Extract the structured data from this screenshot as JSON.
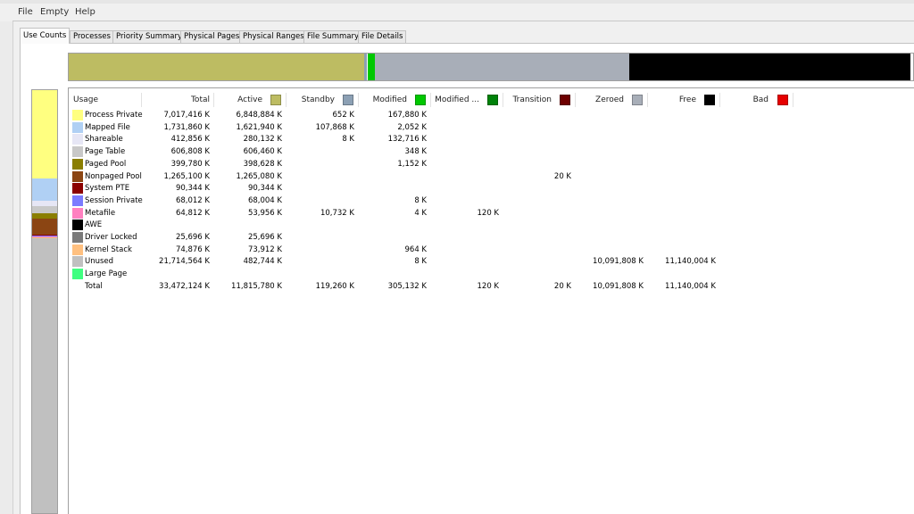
{
  "menu": [
    "File",
    "Empty",
    "Help"
  ],
  "tabs": [
    "Use Counts",
    "Processes",
    "Priority Summary",
    "Physical Pages",
    "Physical Ranges",
    "File Summary",
    "File Details"
  ],
  "active_tab": "Use Counts",
  "columns": [
    {
      "label": "Usage"
    },
    {
      "label": "Total"
    },
    {
      "label": "Active",
      "color": "#bdbc62"
    },
    {
      "label": "Standby",
      "color": "#8ca0b4"
    },
    {
      "label": "Modified",
      "color": "#00c800"
    },
    {
      "label": "Modified ...",
      "color": "#00820a"
    },
    {
      "label": "Transition",
      "color": "#6e0000"
    },
    {
      "label": "Zeroed",
      "color": "#a8aeb8"
    },
    {
      "label": "Free",
      "color": "#000000"
    },
    {
      "label": "Bad",
      "color": "#e60000"
    }
  ],
  "rows": [
    {
      "name": "Process Private",
      "color": "#ffff80",
      "cells": [
        "7,017,416 K",
        "6,848,884 K",
        "652 K",
        "167,880 K",
        "",
        "",
        "",
        "",
        ""
      ]
    },
    {
      "name": "Mapped File",
      "color": "#b0d0f4",
      "cells": [
        "1,731,860 K",
        "1,621,940 K",
        "107,868 K",
        "2,052 K",
        "",
        "",
        "",
        "",
        ""
      ]
    },
    {
      "name": "Shareable",
      "color": "#e6e6f5",
      "cells": [
        "412,856 K",
        "280,132 K",
        "8 K",
        "132,716 K",
        "",
        "",
        "",
        "",
        ""
      ]
    },
    {
      "name": "Page Table",
      "color": "#c8c8c8",
      "cells": [
        "606,808 K",
        "606,460 K",
        "",
        "348 K",
        "",
        "",
        "",
        "",
        ""
      ]
    },
    {
      "name": "Paged Pool",
      "color": "#8a7e00",
      "cells": [
        "399,780 K",
        "398,628 K",
        "",
        "1,152 K",
        "",
        "",
        "",
        "",
        ""
      ]
    },
    {
      "name": "Nonpaged Pool",
      "color": "#8b4513",
      "cells": [
        "1,265,100 K",
        "1,265,080 K",
        "",
        "",
        "",
        "20 K",
        "",
        "",
        ""
      ]
    },
    {
      "name": "System PTE",
      "color": "#8b0000",
      "cells": [
        "90,344 K",
        "90,344 K",
        "",
        "",
        "",
        "",
        "",
        "",
        ""
      ]
    },
    {
      "name": "Session Private",
      "color": "#7b7bff",
      "cells": [
        "68,012 K",
        "68,004 K",
        "",
        "8 K",
        "",
        "",
        "",
        "",
        ""
      ]
    },
    {
      "name": "Metafile",
      "color": "#ff80c0",
      "cells": [
        "64,812 K",
        "53,956 K",
        "10,732 K",
        "4 K",
        "120 K",
        "",
        "",
        "",
        ""
      ]
    },
    {
      "name": "AWE",
      "color": "#000000",
      "cells": [
        "",
        "",
        "",
        "",
        "",
        "",
        "",
        "",
        ""
      ]
    },
    {
      "name": "Driver Locked",
      "color": "#7a7a7a",
      "cells": [
        "25,696 K",
        "25,696 K",
        "",
        "",
        "",
        "",
        "",
        "",
        ""
      ]
    },
    {
      "name": "Kernel Stack",
      "color": "#ffc080",
      "cells": [
        "74,876 K",
        "73,912 K",
        "",
        "964 K",
        "",
        "",
        "",
        "",
        ""
      ]
    },
    {
      "name": "Unused",
      "color": "#c0c0c0",
      "cells": [
        "21,714,564 K",
        "482,744 K",
        "",
        "8 K",
        "",
        "",
        "10,091,808 K",
        "11,140,004 K",
        ""
      ]
    },
    {
      "name": "Large Page",
      "color": "#40ff80",
      "cells": [
        "",
        "",
        "",
        "",
        "",
        "",
        "",
        "",
        ""
      ]
    },
    {
      "name": "Total",
      "color": "",
      "cells": [
        "33,472,124 K",
        "11,815,780 K",
        "119,260 K",
        "305,132 K",
        "120 K",
        "20 K",
        "10,091,808 K",
        "11,140,004 K",
        ""
      ]
    }
  ],
  "overview_bar": [
    {
      "segment": "Active",
      "fraction": 0.35,
      "color": "#bdbc62"
    },
    {
      "segment": "Standby",
      "fraction": 0.0036,
      "color": "#8ca0b4"
    },
    {
      "segment": "Modified",
      "fraction": 0.0091,
      "color": "#00c800"
    },
    {
      "segment": "Zeroed",
      "fraction": 0.3015,
      "color": "#a8aeb8"
    },
    {
      "segment": "Free",
      "fraction": 0.3328,
      "color": "#000000"
    }
  ],
  "usage_bar": [
    {
      "segment": "Process Private",
      "fraction": 0.2097,
      "color": "#ffff80"
    },
    {
      "segment": "Mapped File",
      "fraction": 0.0517,
      "color": "#b0d0f4"
    },
    {
      "segment": "Shareable",
      "fraction": 0.0123,
      "color": "#e6e6f5"
    },
    {
      "segment": "Page Table",
      "fraction": 0.0181,
      "color": "#c8c8c8"
    },
    {
      "segment": "Paged Pool",
      "fraction": 0.0119,
      "color": "#8a7e00"
    },
    {
      "segment": "Nonpaged Pool",
      "fraction": 0.0378,
      "color": "#8b4513"
    },
    {
      "segment": "System PTE",
      "fraction": 0.0027,
      "color": "#8b0000"
    },
    {
      "segment": "Session Private",
      "fraction": 0.002,
      "color": "#7b7bff"
    },
    {
      "segment": "Metafile",
      "fraction": 0.0019,
      "color": "#ff80c0"
    },
    {
      "segment": "Driver Locked",
      "fraction": 0.0008,
      "color": "#7a7a7a"
    },
    {
      "segment": "Kernel Stack",
      "fraction": 0.0022,
      "color": "#ffc080"
    },
    {
      "segment": "Unused",
      "fraction": 0.6488,
      "color": "#c0c0c0"
    }
  ]
}
